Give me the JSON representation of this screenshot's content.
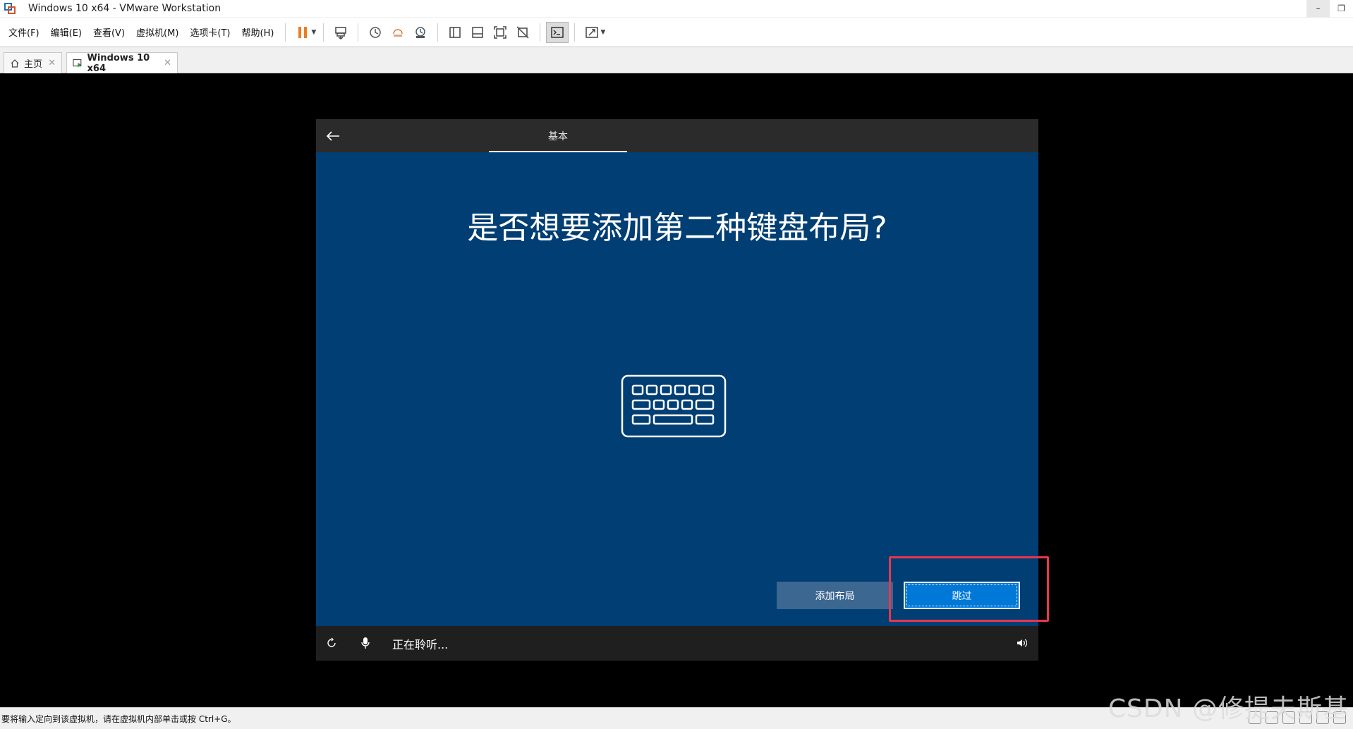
{
  "window": {
    "title": "Windows 10 x64 - VMware Workstation",
    "minimize": "–",
    "restore": "❐"
  },
  "menu": {
    "items": [
      "文件(F)",
      "编辑(E)",
      "查看(V)",
      "虚拟机(M)",
      "选项卡(T)",
      "帮助(H)"
    ]
  },
  "tabs": {
    "home_label": "主页",
    "vm_label": "Windows 10 x64",
    "close_glyph": "✕"
  },
  "oobe": {
    "header_tab": "基本",
    "title": "是否想要添加第二种键盘布局?",
    "add_layout_label": "添加布局",
    "skip_label": "跳过",
    "listening": "正在聆听..."
  },
  "status": {
    "text": "要将输入定向到该虚拟机，请在虚拟机内部单击或按 Ctrl+G。"
  },
  "watermark": "CSDN @修提夫斯基",
  "colors": {
    "oobe_bg": "#003e73",
    "skip_button": "#0078d7",
    "add_button": "#3c6791",
    "highlight": "#e8364f",
    "pause_icon": "#f07c1e"
  }
}
